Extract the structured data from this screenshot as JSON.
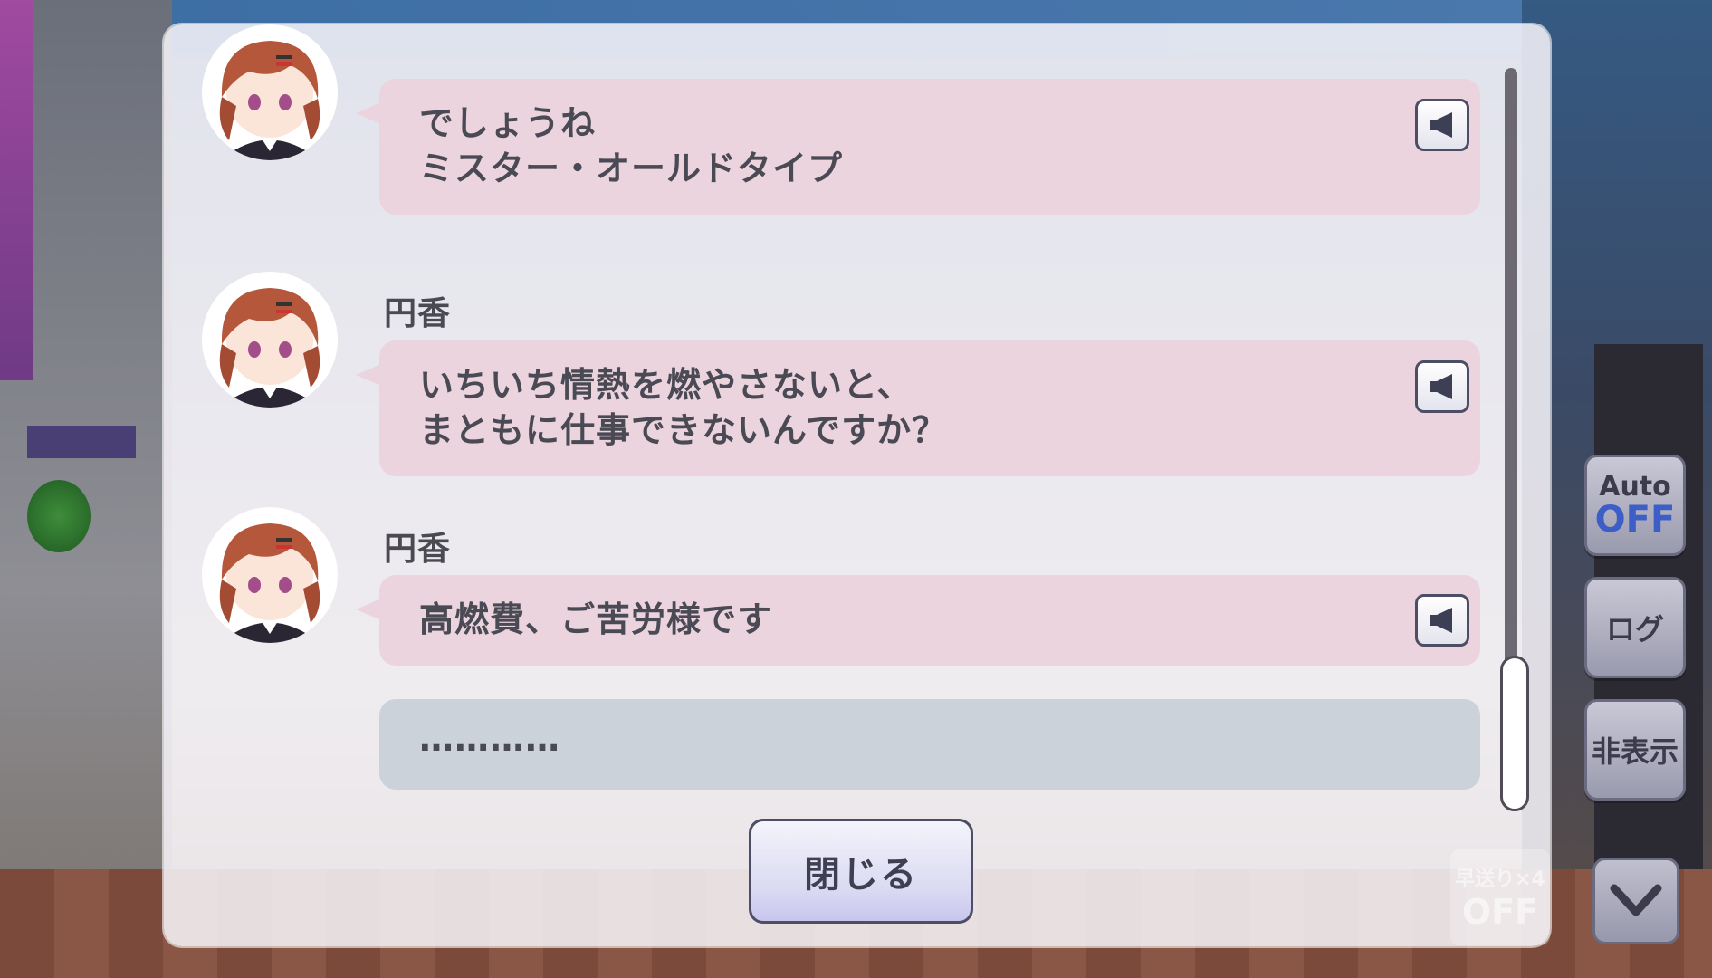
{
  "log": {
    "entries": [
      {
        "speaker": "",
        "lines": "でしょうね\nミスター・オールドタイプ",
        "voice_icon": "speaker-icon"
      },
      {
        "speaker": "円香",
        "lines": "いちいち情熱を燃やさないと、\nまともに仕事できないんですか？",
        "voice_icon": "speaker-icon"
      },
      {
        "speaker": "円香",
        "lines": "高燃費、ご苦労様です",
        "voice_icon": "speaker-icon"
      }
    ],
    "narration": "…………"
  },
  "buttons": {
    "close": "閉じる",
    "auto_top": "Auto",
    "auto_bottom": "OFF",
    "log": "ログ",
    "hide": "非表示",
    "fast_forward_top": "早送り×4",
    "fast_forward_bottom": "OFF"
  },
  "colors": {
    "bubble": "#ecd4df",
    "narration_bubble": "#ccd2da",
    "auto_off": "#3d5ec6"
  }
}
